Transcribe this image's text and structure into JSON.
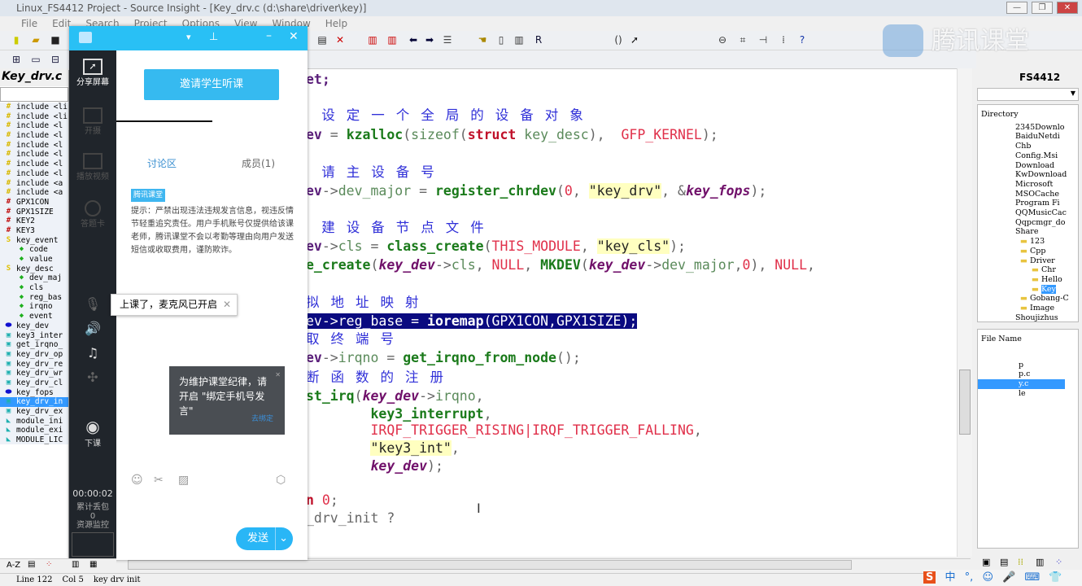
{
  "window": {
    "title": "Linux_FS4412 Project - Source Insight - [Key_drv.c (d:\\share\\driver\\key)]",
    "controls": [
      "—",
      "❐",
      "✕"
    ]
  },
  "menu": [
    "File",
    "Edit",
    "Search",
    "Project",
    "Options",
    "View",
    "Window",
    "Help"
  ],
  "symbol_panel": {
    "title": "Key_drv.c",
    "items": [
      {
        "icon": "hash",
        "color": "#d8b800",
        "label": "include <li"
      },
      {
        "icon": "hash",
        "color": "#d8b800",
        "label": "include <li"
      },
      {
        "icon": "hash",
        "color": "#d8b800",
        "label": "include <l"
      },
      {
        "icon": "hash",
        "color": "#d8b800",
        "label": "include <l"
      },
      {
        "icon": "hash",
        "color": "#d8b800",
        "label": "include <l"
      },
      {
        "icon": "hash",
        "color": "#d8b800",
        "label": "include <l"
      },
      {
        "icon": "hash",
        "color": "#d8b800",
        "label": "include <l"
      },
      {
        "icon": "hash",
        "color": "#d8b800",
        "label": "include <l"
      },
      {
        "icon": "hash",
        "color": "#d8b800",
        "label": "include <a"
      },
      {
        "icon": "hash",
        "color": "#d8b800",
        "label": "include <a"
      },
      {
        "icon": "hash",
        "color": "#c01010",
        "label": "GPX1CON"
      },
      {
        "icon": "hash",
        "color": "#c01010",
        "label": "GPX1SIZE"
      },
      {
        "icon": "hash",
        "color": "#c01010",
        "label": "KEY2"
      },
      {
        "icon": "hash",
        "color": "#c01010",
        "label": "KEY3"
      },
      {
        "icon": "struct",
        "color": "#e0c000",
        "label": "key_event"
      },
      {
        "icon": "member",
        "color": "#20b020",
        "label": "code",
        "level": 2
      },
      {
        "icon": "member",
        "color": "#20b020",
        "label": "value",
        "level": 2
      },
      {
        "icon": "struct",
        "color": "#e0c000",
        "label": "key_desc"
      },
      {
        "icon": "member",
        "color": "#20b020",
        "label": "dev_maj",
        "level": 2
      },
      {
        "icon": "member",
        "color": "#20b020",
        "label": "cls",
        "level": 2
      },
      {
        "icon": "member",
        "color": "#20b020",
        "label": "reg_bas",
        "level": 2
      },
      {
        "icon": "member",
        "color": "#20b020",
        "label": "irqno",
        "level": 2
      },
      {
        "icon": "member",
        "color": "#20b020",
        "label": "event",
        "level": 2
      },
      {
        "icon": "variable",
        "color": "#1010d0",
        "label": "key_dev"
      },
      {
        "icon": "function",
        "color": "#20b0b0",
        "label": "key3_inter"
      },
      {
        "icon": "function",
        "color": "#20b0b0",
        "label": "get_irqno_"
      },
      {
        "icon": "function",
        "color": "#20b0b0",
        "label": "key_drv_op"
      },
      {
        "icon": "function",
        "color": "#20b0b0",
        "label": "key_drv_re"
      },
      {
        "icon": "function",
        "color": "#20b0b0",
        "label": "key_drv_wr"
      },
      {
        "icon": "function",
        "color": "#20b0b0",
        "label": "key_drv_cl"
      },
      {
        "icon": "variable",
        "color": "#1010d0",
        "label": "key_fops"
      },
      {
        "icon": "function",
        "color": "#20b0b0",
        "label": "key_drv_in",
        "selected": true
      },
      {
        "icon": "function",
        "color": "#20b0b0",
        "label": "key_drv_ex"
      },
      {
        "icon": "macro",
        "color": "#20b0b0",
        "label": "module_ini"
      },
      {
        "icon": "macro",
        "color": "#20b0b0",
        "label": "module_exi"
      },
      {
        "icon": "macro",
        "color": "#20b0b0",
        "label": "MODULE_LIC"
      }
    ]
  },
  "classroom": {
    "side": [
      {
        "icon": "share-screen-icon",
        "label": "分享屏幕"
      },
      {
        "icon": "camera-icon",
        "label": "开摄"
      },
      {
        "icon": "screen-record-icon",
        "label": "播放视频"
      },
      {
        "icon": "settings-icon",
        "label": "答题卡"
      }
    ],
    "side_icons": [
      "microphone-icon",
      "speaker-icon",
      "music-icon",
      "expand-icon"
    ],
    "end_class": "下课",
    "timer": "00:00:02",
    "packet_loss_label": "累计丢包",
    "packet_loss": "0",
    "resource_monitor": "资源监控",
    "invite_button": "邀请学生听课",
    "tabs": [
      "讨论区",
      "成员(1)"
    ],
    "badge": "腾讯课堂",
    "notice": "提示：严禁出现违法违规发言信息，视违反情节轻重追究责任。用户手机账号仅提供给该课老师，腾讯课堂不会以考勤等理由向用户发送短信或收取费用，谨防欺诈。",
    "mic_tooltip": "上课了，麦克风已开启",
    "popup_text": "为维护课堂纪律，请开启 \"绑定手机号发言\"",
    "popup_link": "去绑定",
    "send_button": "发送"
  },
  "code": [
    [
      {
        "c": "kw",
        "t": "et;"
      }
    ],
    [
      {
        "c": "cmt",
        "t": " 设定一个全局的设备对象"
      }
    ],
    [
      {
        "c": "kw",
        "t": "ev"
      },
      {
        "c": "op",
        "t": " = "
      },
      {
        "c": "fn",
        "t": "kzalloc"
      },
      {
        "c": "op",
        "t": "("
      },
      {
        "c": "id",
        "t": "sizeof"
      },
      {
        "c": "op",
        "t": "("
      },
      {
        "c": "rk",
        "t": "struct"
      },
      {
        "c": "id",
        "t": " key_desc"
      },
      {
        "c": "op",
        "t": "),  "
      },
      {
        "c": "cst",
        "t": "GFP_KERNEL"
      },
      {
        "c": "op",
        "t": ");"
      }
    ],
    [
      {
        "c": "cmt",
        "t": " 请主设备号"
      }
    ],
    [
      {
        "c": "kw",
        "t": "ev"
      },
      {
        "c": "op",
        "t": "->"
      },
      {
        "c": "id",
        "t": "dev_major"
      },
      {
        "c": "op",
        "t": " = "
      },
      {
        "c": "fn",
        "t": "register_chrdev"
      },
      {
        "c": "op",
        "t": "("
      },
      {
        "c": "cst",
        "t": "0"
      },
      {
        "c": "op",
        "t": ", "
      },
      {
        "c": "str",
        "t": "\"key_drv\""
      },
      {
        "c": "op",
        "t": ", &"
      },
      {
        "c": "it",
        "t": "key_fops"
      },
      {
        "c": "op",
        "t": ");"
      }
    ],
    [
      {
        "c": "cmt",
        "t": " 建设备节点文件"
      }
    ],
    [
      {
        "c": "kw",
        "t": "ev"
      },
      {
        "c": "op",
        "t": "->"
      },
      {
        "c": "id",
        "t": "cls"
      },
      {
        "c": "op",
        "t": " = "
      },
      {
        "c": "fn",
        "t": "class_create"
      },
      {
        "c": "op",
        "t": "("
      },
      {
        "c": "cst",
        "t": "THIS_MODULE"
      },
      {
        "c": "op",
        "t": ", "
      },
      {
        "c": "str",
        "t": "\"key_cls\""
      },
      {
        "c": "op",
        "t": ");"
      }
    ],
    [
      {
        "c": "fn",
        "t": "e_create"
      },
      {
        "c": "op",
        "t": "("
      },
      {
        "c": "it",
        "t": "key_dev"
      },
      {
        "c": "op",
        "t": "->"
      },
      {
        "c": "id",
        "t": "cls"
      },
      {
        "c": "op",
        "t": ", "
      },
      {
        "c": "cst",
        "t": "NULL"
      },
      {
        "c": "op",
        "t": ", "
      },
      {
        "c": "fn",
        "t": "MKDEV"
      },
      {
        "c": "op",
        "t": "("
      },
      {
        "c": "it",
        "t": "key_dev"
      },
      {
        "c": "op",
        "t": "->"
      },
      {
        "c": "id",
        "t": "dev_major"
      },
      {
        "c": "op",
        "t": ","
      },
      {
        "c": "cst",
        "t": "0"
      },
      {
        "c": "op",
        "t": "), "
      },
      {
        "c": "cst",
        "t": "NULL"
      },
      {
        "c": "op",
        "t": ","
      }
    ],
    [
      {
        "c": "cmt",
        "t": "拟地址映射"
      }
    ],
    [
      {
        "c": "hl",
        "t": "ev->reg_base = ",
        "parts": [
          {
            "c": "",
            "t": "ev->reg_base = "
          },
          {
            "c": "fn",
            "t": "ioremap"
          },
          {
            "c": "",
            "t": "(GPX1CON,GPX1SIZE);"
          }
        ]
      }
    ],
    [
      {
        "c": "cmt",
        "t": "取终端号"
      }
    ],
    [
      {
        "c": "kw",
        "t": "ev"
      },
      {
        "c": "op",
        "t": "->"
      },
      {
        "c": "id",
        "t": "irqno"
      },
      {
        "c": "op",
        "t": " = "
      },
      {
        "c": "fn",
        "t": "get_irqno_from_node"
      },
      {
        "c": "op",
        "t": "();"
      }
    ],
    [
      {
        "c": "cmt",
        "t": "断函数的注册"
      }
    ],
    [
      {
        "c": "fn",
        "t": "st_irq"
      },
      {
        "c": "op",
        "t": "("
      },
      {
        "c": "it",
        "t": "key_dev"
      },
      {
        "c": "op",
        "t": "->"
      },
      {
        "c": "id",
        "t": "irqno"
      },
      {
        "c": "op",
        "t": ","
      }
    ],
    [
      {
        "c": "pl",
        "t": "        "
      },
      {
        "c": "fn",
        "t": "key3_interrupt"
      },
      {
        "c": "op",
        "t": ","
      }
    ],
    [
      {
        "c": "pl",
        "t": "        "
      },
      {
        "c": "cst",
        "t": "IRQF_TRIGGER_RISING|IRQF_TRIGGER_FALLING"
      },
      {
        "c": "op",
        "t": ","
      }
    ],
    [
      {
        "c": "pl",
        "t": "        "
      },
      {
        "c": "str",
        "t": "\"key3_int\""
      },
      {
        "c": "op",
        "t": ","
      }
    ],
    [
      {
        "c": "pl",
        "t": "        "
      },
      {
        "c": "it",
        "t": "key_dev"
      },
      {
        "c": "op",
        "t": ");"
      }
    ],
    [
      {
        "c": "rk",
        "t": "n"
      },
      {
        "c": "cst",
        "t": " 0"
      },
      {
        "c": "op",
        "t": ";"
      }
    ],
    [
      {
        "c": "op",
        "t": "_drv_init ?"
      }
    ]
  ],
  "right_panel": {
    "title": "FS4412",
    "directory_header": "Directory",
    "directories": [
      "2345Downlo",
      "BaiduNetdi",
      "Chb",
      "Config.Msi",
      "Download",
      "KwDownload",
      "Microsoft",
      "MSOCache",
      "Program Fi",
      "QQMusicCac",
      "Qqpcmgr_do",
      "Share",
      "123",
      "Cpp",
      "Driver",
      "Chr",
      "Hello",
      "Key",
      "Gobang-C",
      "Image",
      "Shoujizhus"
    ],
    "file_header": "File Name",
    "files": [
      "p",
      "p.c",
      "y.c",
      "le"
    ]
  },
  "status": {
    "line": "Line 122",
    "col": "Col 5",
    "symbol": "key drv init"
  },
  "watermark": "腾讯课堂",
  "tray": [
    "中",
    "°,",
    "☺",
    "🎤",
    "⌨",
    "👕"
  ]
}
